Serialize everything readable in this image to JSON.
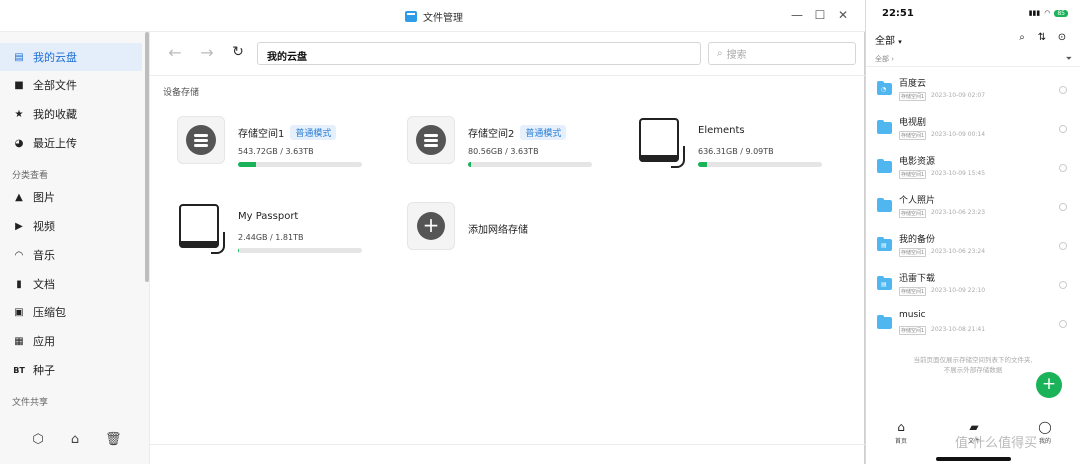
{
  "window": {
    "title": "文件管理"
  },
  "sidebar": {
    "items": [
      {
        "label": "我的云盘",
        "icon": "storage-icon"
      },
      {
        "label": "全部文件",
        "icon": "folder-icon"
      },
      {
        "label": "我的收藏",
        "icon": "star-icon"
      },
      {
        "label": "最近上传",
        "icon": "clock-icon"
      }
    ],
    "section_category": "分类查看",
    "categories": [
      {
        "label": "图片",
        "icon": "image-icon"
      },
      {
        "label": "视频",
        "icon": "video-icon"
      },
      {
        "label": "音乐",
        "icon": "headphones-icon"
      },
      {
        "label": "文档",
        "icon": "document-icon"
      },
      {
        "label": "压缩包",
        "icon": "archive-icon"
      },
      {
        "label": "应用",
        "icon": "apps-icon"
      },
      {
        "label": "种子",
        "icon": "torrent-icon",
        "glyph": "BT"
      }
    ],
    "section_share": "文件共享"
  },
  "toolbar": {
    "path": "我的云盘",
    "search_placeholder": "搜索"
  },
  "main": {
    "section_label": "设备存储",
    "devices": [
      {
        "name": "存储空间1",
        "badge": "普通模式",
        "size": "543.72GB / 3.63TB",
        "used_fraction": 0.146,
        "kind": "internal"
      },
      {
        "name": "存储空间2",
        "badge": "普通模式",
        "size": "80.56GB / 3.63TB",
        "used_fraction": 0.022,
        "kind": "internal"
      },
      {
        "name": "Elements",
        "badge": "",
        "size": "636.31GB / 9.09TB",
        "used_fraction": 0.07,
        "kind": "external"
      },
      {
        "name": "My Passport",
        "badge": "",
        "size": "2.44GB / 1.81TB",
        "used_fraction": 0.0013,
        "kind": "external"
      }
    ],
    "add_label": "添加网络存储"
  },
  "phone": {
    "time": "22:51",
    "battery": "85",
    "header": "全部",
    "crumb": "全部",
    "items": [
      {
        "name": "百度云",
        "tag": "存储空间1",
        "date": "2023-10-09 02:07",
        "glyph": "◔"
      },
      {
        "name": "电视剧",
        "tag": "存储空间1",
        "date": "2023-10-09 00:14",
        "glyph": ""
      },
      {
        "name": "电影资源",
        "tag": "存储空间1",
        "date": "2023-10-09 15:45",
        "glyph": ""
      },
      {
        "name": "个人照片",
        "tag": "存储空间1",
        "date": "2023-10-06 23:23",
        "glyph": ""
      },
      {
        "name": "我的备份",
        "tag": "存储空间1",
        "date": "2023-10-06 23:24",
        "glyph": "▤"
      },
      {
        "name": "迅雷下载",
        "tag": "存储空间1",
        "date": "2023-10-09 22:10",
        "glyph": "▤"
      },
      {
        "name": "music",
        "tag": "存储空间1",
        "date": "2023-10-08 21:41",
        "glyph": ""
      }
    ],
    "note_line1": "当前页面仅展示存储空间列表下的文件夹,",
    "note_line2": "不展示外部存储数据",
    "tabs": [
      {
        "label": "首页",
        "icon": "home-icon"
      },
      {
        "label": "文件",
        "icon": "folder-icon"
      },
      {
        "label": "我的",
        "icon": "profile-icon"
      }
    ],
    "watermark": "值 什么值得买"
  }
}
